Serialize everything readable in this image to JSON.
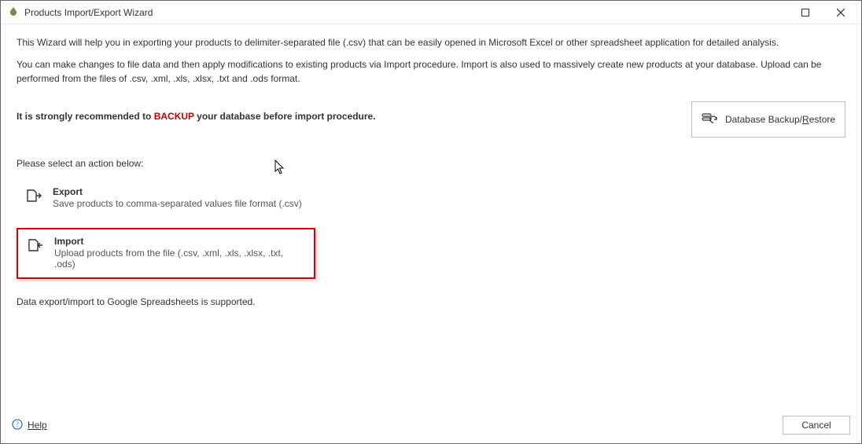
{
  "window": {
    "title": "Products Import/Export Wizard"
  },
  "intro": {
    "p1": "This Wizard will help you in exporting your products to delimiter-separated file (.csv) that can be easily opened in Microsoft Excel or other spreadsheet application for detailed analysis.",
    "p2": "You can make changes to file data and then apply modifications to existing products via Import procedure. Import is also used to massively create new products at your database. Upload can be performed from the files of .csv, .xml, .xls, .xlsx, .txt and .ods format."
  },
  "recommendation": {
    "prefix": "It is strongly recommended to ",
    "backup_word": "BACKUP",
    "suffix": " your database before import procedure."
  },
  "backup_button": {
    "label_pre": "Database Backup/",
    "label_underlined": "R",
    "label_post": "estore"
  },
  "action_prompt": "Please select an action below:",
  "options": {
    "export": {
      "title": "Export",
      "desc": "Save products to comma-separated values file format (.csv)"
    },
    "import": {
      "title": "Import",
      "desc": "Upload products from the file (.csv, .xml, .xls, .xlsx, .txt, .ods)",
      "selected": true
    }
  },
  "google_note": "Data export/import to Google Spreadsheets is supported.",
  "footer": {
    "help": "Help",
    "cancel": "Cancel"
  }
}
